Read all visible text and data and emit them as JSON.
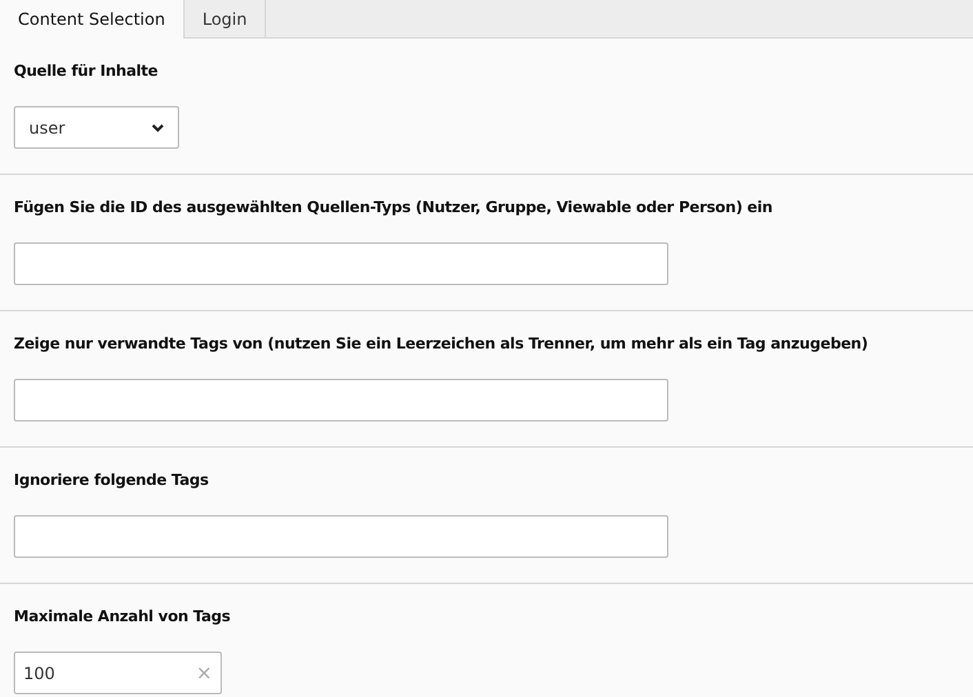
{
  "tabs": [
    {
      "label": "Content Selection",
      "selected": true
    },
    {
      "label": "Login",
      "selected": false
    }
  ],
  "fields": [
    {
      "kind": "select",
      "label": "Quelle für Inhalte",
      "value": "user"
    },
    {
      "kind": "text",
      "label": "Fügen Sie die ID des ausgewählten Quellen-Typs (Nutzer, Gruppe, Viewable oder Person) ein"
    },
    {
      "kind": "text",
      "label": "Zeige nur verwandte Tags von (nutzen Sie ein Leerzeichen als Trenner, um mehr als ein Tag anzugeben)"
    },
    {
      "kind": "text",
      "label": "Ignoriere folgende Tags"
    },
    {
      "kind": "clearable",
      "label": "Maximale Anzahl von Tags",
      "value": "100",
      "clear": "×"
    }
  ]
}
